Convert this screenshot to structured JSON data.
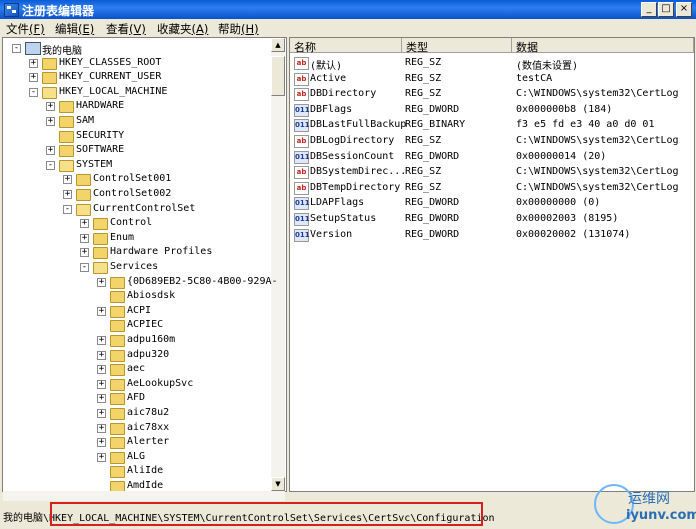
{
  "window": {
    "title": "注册表编辑器",
    "controls": [
      "_",
      "□",
      "×"
    ]
  },
  "menu": [
    {
      "label": "文件",
      "key": "(F)"
    },
    {
      "label": "编辑",
      "key": "(E)"
    },
    {
      "label": "查看",
      "key": "(V)"
    },
    {
      "label": "收藏夹",
      "key": "(A)"
    },
    {
      "label": "帮助",
      "key": "(H)"
    }
  ],
  "tree": [
    {
      "label": "我的电脑",
      "depth": 0,
      "exp": "-",
      "icon": "computer"
    },
    {
      "label": "HKEY_CLASSES_ROOT",
      "depth": 1,
      "exp": "+",
      "icon": "folder"
    },
    {
      "label": "HKEY_CURRENT_USER",
      "depth": 1,
      "exp": "+",
      "icon": "folder"
    },
    {
      "label": "HKEY_LOCAL_MACHINE",
      "depth": 1,
      "exp": "-",
      "icon": "folder-open"
    },
    {
      "label": "HARDWARE",
      "depth": 2,
      "exp": "+",
      "icon": "folder"
    },
    {
      "label": "SAM",
      "depth": 2,
      "exp": "+",
      "icon": "folder"
    },
    {
      "label": "SECURITY",
      "depth": 2,
      "exp": "",
      "icon": "folder"
    },
    {
      "label": "SOFTWARE",
      "depth": 2,
      "exp": "+",
      "icon": "folder"
    },
    {
      "label": "SYSTEM",
      "depth": 2,
      "exp": "-",
      "icon": "folder-open"
    },
    {
      "label": "ControlSet001",
      "depth": 3,
      "exp": "+",
      "icon": "folder"
    },
    {
      "label": "ControlSet002",
      "depth": 3,
      "exp": "+",
      "icon": "folder"
    },
    {
      "label": "CurrentControlSet",
      "depth": 3,
      "exp": "-",
      "icon": "folder-open"
    },
    {
      "label": "Control",
      "depth": 4,
      "exp": "+",
      "icon": "folder"
    },
    {
      "label": "Enum",
      "depth": 4,
      "exp": "+",
      "icon": "folder"
    },
    {
      "label": "Hardware Profiles",
      "depth": 4,
      "exp": "+",
      "icon": "folder"
    },
    {
      "label": "Services",
      "depth": 4,
      "exp": "-",
      "icon": "folder-open"
    },
    {
      "label": "{0D689EB2-5C80-4B00-929A-",
      "depth": 5,
      "exp": "+",
      "icon": "folder"
    },
    {
      "label": "Abiosdsk",
      "depth": 5,
      "exp": "",
      "icon": "folder"
    },
    {
      "label": "ACPI",
      "depth": 5,
      "exp": "+",
      "icon": "folder"
    },
    {
      "label": "ACPIEC",
      "depth": 5,
      "exp": "",
      "icon": "folder"
    },
    {
      "label": "adpu160m",
      "depth": 5,
      "exp": "+",
      "icon": "folder"
    },
    {
      "label": "adpu320",
      "depth": 5,
      "exp": "+",
      "icon": "folder"
    },
    {
      "label": "aec",
      "depth": 5,
      "exp": "+",
      "icon": "folder"
    },
    {
      "label": "AeLookupSvc",
      "depth": 5,
      "exp": "+",
      "icon": "folder"
    },
    {
      "label": "AFD",
      "depth": 5,
      "exp": "+",
      "icon": "folder"
    },
    {
      "label": "aic78u2",
      "depth": 5,
      "exp": "+",
      "icon": "folder"
    },
    {
      "label": "aic78xx",
      "depth": 5,
      "exp": "+",
      "icon": "folder"
    },
    {
      "label": "Alerter",
      "depth": 5,
      "exp": "+",
      "icon": "folder"
    },
    {
      "label": "ALG",
      "depth": 5,
      "exp": "+",
      "icon": "folder"
    },
    {
      "label": "AliIde",
      "depth": 5,
      "exp": "",
      "icon": "folder"
    },
    {
      "label": "AmdIde",
      "depth": 5,
      "exp": "",
      "icon": "folder"
    }
  ],
  "columns": [
    "名称",
    "类型",
    "数据"
  ],
  "values": [
    {
      "name": "(默认)",
      "type": "REG_SZ",
      "data": "(数值未设置)",
      "icon": "sz"
    },
    {
      "name": "Active",
      "type": "REG_SZ",
      "data": "testCA",
      "icon": "sz"
    },
    {
      "name": "DBDirectory",
      "type": "REG_SZ",
      "data": "C:\\WINDOWS\\system32\\CertLog",
      "icon": "sz"
    },
    {
      "name": "DBFlags",
      "type": "REG_DWORD",
      "data": "0x000000b8 (184)",
      "icon": "bin"
    },
    {
      "name": "DBLastFullBackup",
      "type": "REG_BINARY",
      "data": "f3 e5 fd e3 40 a0 d0 01",
      "icon": "bin"
    },
    {
      "name": "DBLogDirectory",
      "type": "REG_SZ",
      "data": "C:\\WINDOWS\\system32\\CertLog",
      "icon": "sz"
    },
    {
      "name": "DBSessionCount",
      "type": "REG_DWORD",
      "data": "0x00000014 (20)",
      "icon": "bin"
    },
    {
      "name": "DBSystemDirec...",
      "type": "REG_SZ",
      "data": "C:\\WINDOWS\\system32\\CertLog",
      "icon": "sz"
    },
    {
      "name": "DBTempDirectory",
      "type": "REG_SZ",
      "data": "C:\\WINDOWS\\system32\\CertLog",
      "icon": "sz"
    },
    {
      "name": "LDAPFlags",
      "type": "REG_DWORD",
      "data": "0x00000000 (0)",
      "icon": "bin"
    },
    {
      "name": "SetupStatus",
      "type": "REG_DWORD",
      "data": "0x00002003 (8195)",
      "icon": "bin"
    },
    {
      "name": "Version",
      "type": "REG_DWORD",
      "data": "0x00020002 (131074)",
      "icon": "bin"
    }
  ],
  "status": {
    "path": "我的电脑\\HKEY_LOCAL_MACHINE\\SYSTEM\\CurrentControlSet\\Services\\CertSvc\\Configuration"
  },
  "watermark": {
    "line1": "运维网",
    "line2": "iyunv.com"
  }
}
